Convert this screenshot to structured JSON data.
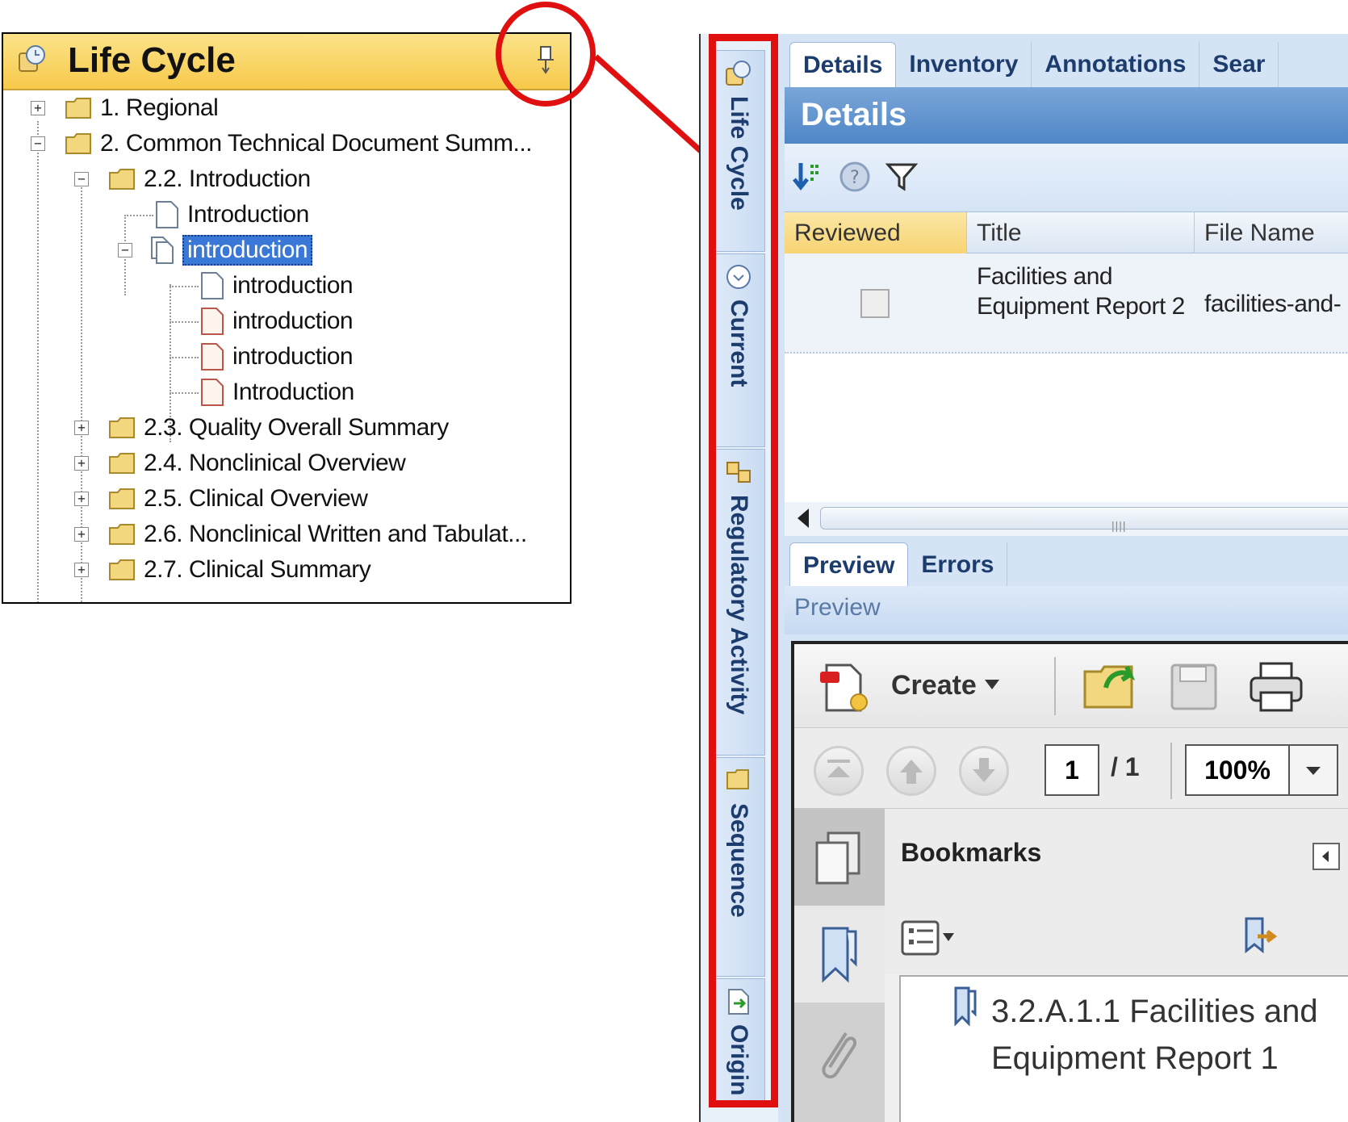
{
  "life_cycle_panel": {
    "title": "Life Cycle",
    "tree": [
      {
        "label": "1. Regional"
      },
      {
        "label": "2. Common Technical Document Summ..."
      },
      {
        "label": "2.2. Introduction"
      },
      {
        "label": "Introduction"
      },
      {
        "label": "introduction",
        "selected": true
      },
      {
        "label": "introduction"
      },
      {
        "label": "introduction"
      },
      {
        "label": "introduction"
      },
      {
        "label": "Introduction"
      },
      {
        "label": "2.3. Quality Overall Summary"
      },
      {
        "label": "2.4. Nonclinical Overview"
      },
      {
        "label": "2.5. Clinical Overview"
      },
      {
        "label": "2.6. Nonclinical Written and Tabulat..."
      },
      {
        "label": "2.7. Clinical Summary"
      }
    ]
  },
  "side_tabs": [
    "Life Cycle",
    "Current",
    "Regulatory Activity",
    "Sequence",
    "Origin"
  ],
  "top_tabs": [
    "Details",
    "Inventory",
    "Annotations",
    "Sear"
  ],
  "details": {
    "title": "Details",
    "columns": [
      "Reviewed",
      "Title",
      "File Name"
    ],
    "row": {
      "reviewed": false,
      "title": "Facilities and Equipment Report 2",
      "file_name": "facilities-and-"
    }
  },
  "bottom_tabs": [
    "Preview",
    "Errors"
  ],
  "preview": {
    "label": "Preview",
    "create_label": "Create",
    "page_current": "1",
    "page_total": "/ 1",
    "zoom": "100%",
    "bookmarks_title": "Bookmarks",
    "bookmark_item": "3.2.A.1.1 Facilities and Equipment Report 1"
  },
  "colors": {
    "highlight": "#e01010",
    "header_gold": "#f7c94a",
    "accent_blue": "#4f86c6"
  }
}
